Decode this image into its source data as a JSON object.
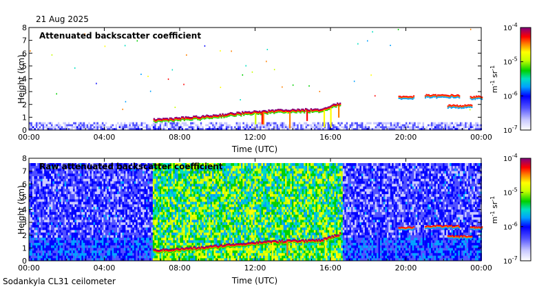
{
  "header": {
    "date": "21 Aug 2025"
  },
  "footer": {
    "station": "Sodankyla CL31 ceilometer"
  },
  "chart_data": [
    {
      "type": "heatmap",
      "title": "Attenuated backscatter coefficient",
      "xlabel": "Time (UTC)",
      "ylabel": "Height (km)",
      "xlim_hours": [
        0,
        24
      ],
      "x_ticks": [
        "00:00",
        "04:00",
        "08:00",
        "12:00",
        "16:00",
        "20:00",
        "00:00"
      ],
      "ylim": [
        0,
        8
      ],
      "y_ticks": [
        "0",
        "1",
        "2",
        "3",
        "4",
        "5",
        "6",
        "7",
        "8"
      ],
      "colorbar": {
        "scale": "log",
        "unit": "m-1 sr-1",
        "tick_labels": [
          {
            "base": "10",
            "exp": "-7"
          },
          {
            "base": "10",
            "exp": "-6"
          },
          {
            "base": "10",
            "exp": "-5"
          },
          {
            "base": "10",
            "exp": "-4"
          }
        ],
        "range": [
          1e-07,
          0.0001
        ]
      },
      "features": {
        "surface_noise_layer_top_km": 0.6,
        "cloud_base_trend": [
          {
            "hour": 6.6,
            "height_km": 0.7
          },
          {
            "hour": 9.0,
            "height_km": 0.9
          },
          {
            "hour": 11.0,
            "height_km": 1.2
          },
          {
            "hour": 13.0,
            "height_km": 1.4
          },
          {
            "hour": 15.5,
            "height_km": 1.5
          },
          {
            "hour": 16.5,
            "height_km": 2.0
          }
        ],
        "upper_cloud_patches": [
          {
            "start_hour": 19.6,
            "end_hour": 20.4,
            "height_km": 2.5
          },
          {
            "start_hour": 21.0,
            "end_hour": 22.8,
            "height_km": 2.6
          },
          {
            "start_hour": 22.2,
            "end_hour": 23.5,
            "height_km": 1.8
          },
          {
            "start_hour": 23.4,
            "end_hour": 24.0,
            "height_km": 2.5
          }
        ]
      }
    },
    {
      "type": "heatmap",
      "title": "Raw attenuated backscatter coefficient",
      "xlabel": "Time (UTC)",
      "ylabel": "Height (km)",
      "xlim_hours": [
        0,
        24
      ],
      "x_ticks": [
        "00:00",
        "04:00",
        "08:00",
        "12:00",
        "16:00",
        "20:00",
        "00:00"
      ],
      "ylim": [
        0,
        8
      ],
      "y_ticks": [
        "0",
        "1",
        "2",
        "3",
        "4",
        "5",
        "6",
        "7",
        "8"
      ],
      "colorbar": {
        "scale": "log",
        "unit": "m-1 sr-1",
        "tick_labels": [
          {
            "base": "10",
            "exp": "-7"
          },
          {
            "base": "10",
            "exp": "-6"
          },
          {
            "base": "10",
            "exp": "-5"
          },
          {
            "base": "10",
            "exp": "-4"
          }
        ],
        "range": [
          1e-07,
          0.0001
        ]
      },
      "features": {
        "daytime_noise_window_hours": [
          6.5,
          16.6
        ],
        "background_noise_top_km": 7.6,
        "cloud_base_trend": [
          {
            "hour": 6.6,
            "height_km": 0.7
          },
          {
            "hour": 9.0,
            "height_km": 0.9
          },
          {
            "hour": 11.0,
            "height_km": 1.2
          },
          {
            "hour": 13.0,
            "height_km": 1.4
          },
          {
            "hour": 15.5,
            "height_km": 1.5
          },
          {
            "hour": 16.5,
            "height_km": 2.0
          }
        ],
        "upper_cloud_patches": [
          {
            "start_hour": 19.6,
            "end_hour": 20.4,
            "height_km": 2.5
          },
          {
            "start_hour": 21.0,
            "end_hour": 22.8,
            "height_km": 2.6
          },
          {
            "start_hour": 22.2,
            "end_hour": 23.5,
            "height_km": 1.8
          },
          {
            "start_hour": 23.4,
            "end_hour": 24.0,
            "height_km": 2.5
          }
        ]
      }
    }
  ]
}
